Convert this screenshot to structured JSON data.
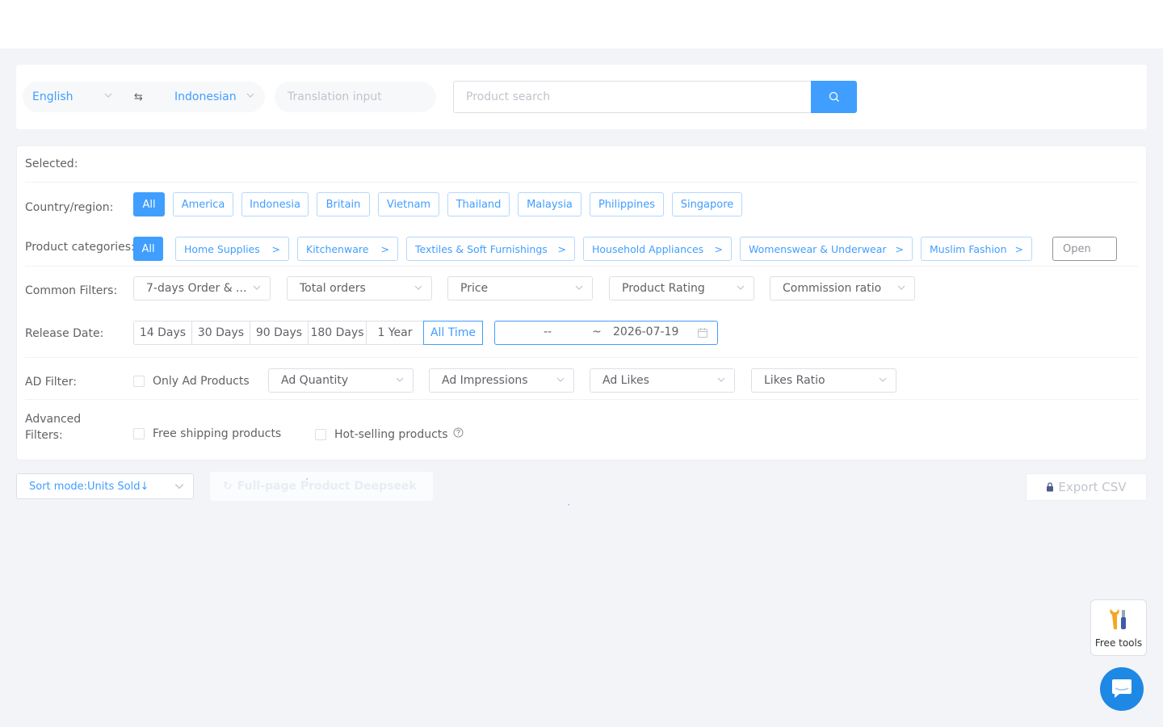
{
  "search": {
    "source_lang": "English",
    "target_lang": "Indonesian",
    "translation_placeholder": "Translation input",
    "product_placeholder": "Product search"
  },
  "filters": {
    "selected_label": "Selected:",
    "country_label": "Country/region:",
    "countries": [
      "All",
      "America",
      "Indonesia",
      "Britain",
      "Vietnam",
      "Thailand",
      "Malaysia",
      "Philippines",
      "Singapore"
    ],
    "category_label": "Product categories:",
    "categories": [
      "All",
      "Home Supplies",
      "Kitchenware",
      "Textiles & Soft Furnishings",
      "Household Appliances",
      "Womenswear & Underwear",
      "Muslim Fashion"
    ],
    "category_arrow": ">",
    "open_label": "Open",
    "common_label": "Common Filters:",
    "common": [
      "7-days Order & ...",
      "Total orders",
      "Price",
      "Product Rating",
      "Commission ratio"
    ],
    "release_label": "Release Date:",
    "release_options": [
      "14 Days",
      "30 Days",
      "90 Days",
      "180 Days",
      "1 Year",
      "All Time"
    ],
    "date_start": "--",
    "date_sep": "~",
    "date_end": "2026-07-19",
    "ad_label": "AD Filter:",
    "ad_checkbox": "Only Ad Products",
    "ad_selects": [
      "Ad Quantity",
      "Ad Impressions",
      "Ad Likes",
      "Likes Ratio"
    ],
    "advanced_label": "Advanced Filters:",
    "advanced": [
      "Free shipping products",
      "Hot-selling products"
    ]
  },
  "bottom": {
    "sort_label": "Sort mode:Units Sold↓",
    "deepseek_label": "Full-page Product Deepseek",
    "export_label": "Export CSV"
  },
  "floating": {
    "free_tools": "Free tools"
  },
  "colors": {
    "accent": "#409eff",
    "chat": "#1e88e5"
  }
}
